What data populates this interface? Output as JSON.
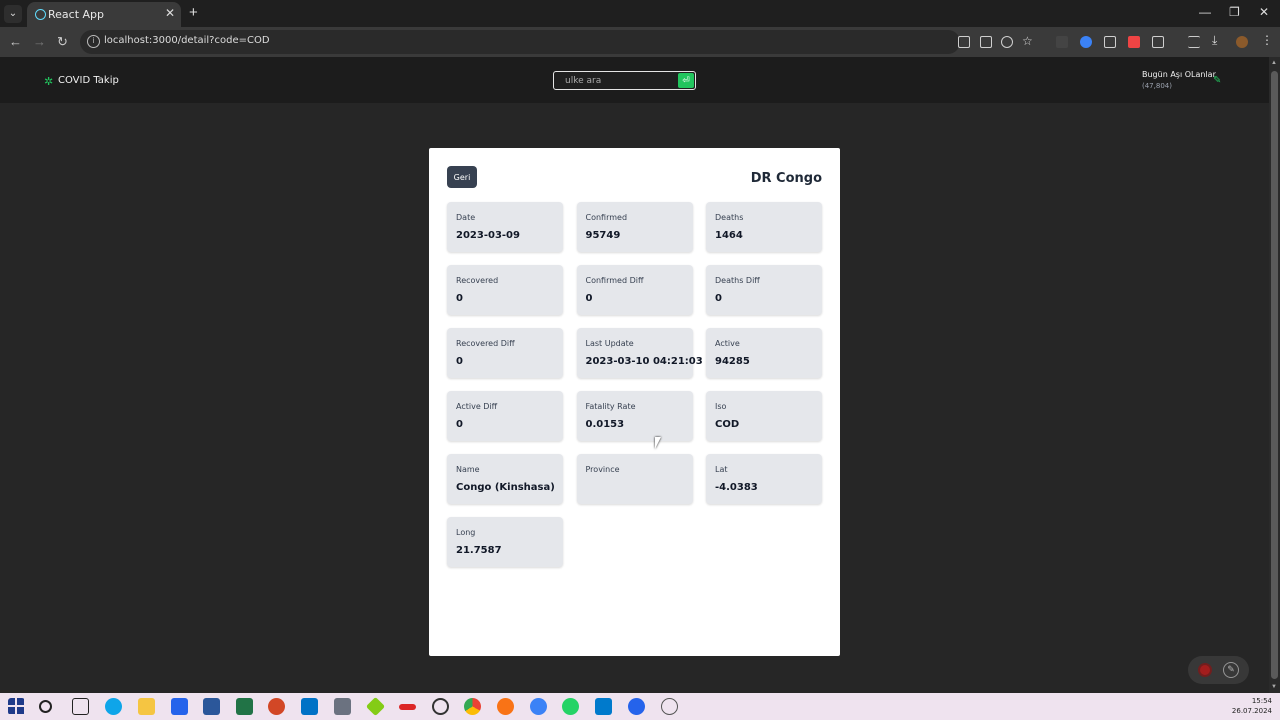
{
  "browser": {
    "tab_title": "React App",
    "url": "localhost:3000/detail?code=COD",
    "new_tab_symbol": "+",
    "tab_close_symbol": "✕"
  },
  "app": {
    "brand": "COVID Takip",
    "search_placeholder": "ulke ara",
    "search_button_icon": "⏎",
    "vaccinated_title": "Bugün Aşı OLanlar",
    "vaccinated_count": "(47,804)"
  },
  "detail": {
    "back_label": "Geri",
    "country": "DR Congo",
    "stats": [
      {
        "label": "Date",
        "value": "2023-03-09"
      },
      {
        "label": "Confirmed",
        "value": "95749"
      },
      {
        "label": "Deaths",
        "value": "1464"
      },
      {
        "label": "Recovered",
        "value": "0"
      },
      {
        "label": "Confirmed Diff",
        "value": "0"
      },
      {
        "label": "Deaths Diff",
        "value": "0"
      },
      {
        "label": "Recovered Diff",
        "value": "0"
      },
      {
        "label": "Last Update",
        "value": "2023-03-10 04:21:03"
      },
      {
        "label": "Active",
        "value": "94285"
      },
      {
        "label": "Active Diff",
        "value": "0"
      },
      {
        "label": "Fatality Rate",
        "value": "0.0153"
      },
      {
        "label": "Iso",
        "value": "COD"
      },
      {
        "label": "Name",
        "value": "Congo (Kinshasa)"
      },
      {
        "label": "Province",
        "value": ""
      },
      {
        "label": "Lat",
        "value": "-4.0383"
      },
      {
        "label": "Long",
        "value": "21.7587"
      }
    ]
  },
  "taskbar": {
    "time": "15:54",
    "date": "26.07.2024"
  },
  "colors": {
    "accent": "#22c55e",
    "card_bg": "#ffffff",
    "stat_bg": "#e5e7eb",
    "back_button": "#374151",
    "page_bg": "#262626"
  }
}
